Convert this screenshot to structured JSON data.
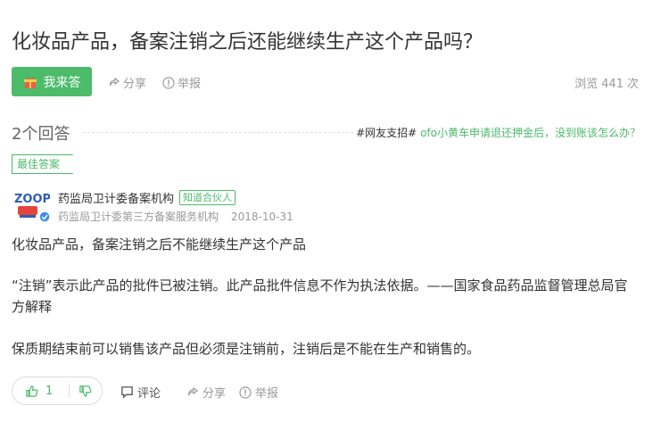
{
  "question": {
    "title": "化妆品产品，备案注销之后还能继续生产这个产品吗？",
    "answer_button": "我来答",
    "share": "分享",
    "report": "举报",
    "views_label": "浏览",
    "views_count": "441",
    "views_unit": "次"
  },
  "answers_header": {
    "count_text": "2个回答",
    "hot_tag": "#网友支招#",
    "hot_link": "ofo小黄车申请退还押金后，没到账该怎么办？"
  },
  "best_answer": {
    "badge": "最佳答案",
    "avatar_text": "ZOOP",
    "author": "药监局卫计委备案机构",
    "author_badge": "知道合伙人",
    "author_desc": "药监局卫计委第三方备案服务机构",
    "date": "2018-10-31",
    "paragraphs": [
      "化妆品产品，备案注销之后不能继续生产这个产品",
      "“注销”表示此产品的批件已被注销。此产品批件信息不作为执法依据。——国家食品药品监督管理总局官方解释",
      "保质期结束前可以销售该产品但必须是注销前，注销后是不能在生产和销售的。"
    ],
    "likes": "1",
    "comment": "评论",
    "share": "分享",
    "report": "举报"
  },
  "colors": {
    "accent": "#4cbb6a",
    "text": "#333333",
    "muted": "#999999"
  }
}
